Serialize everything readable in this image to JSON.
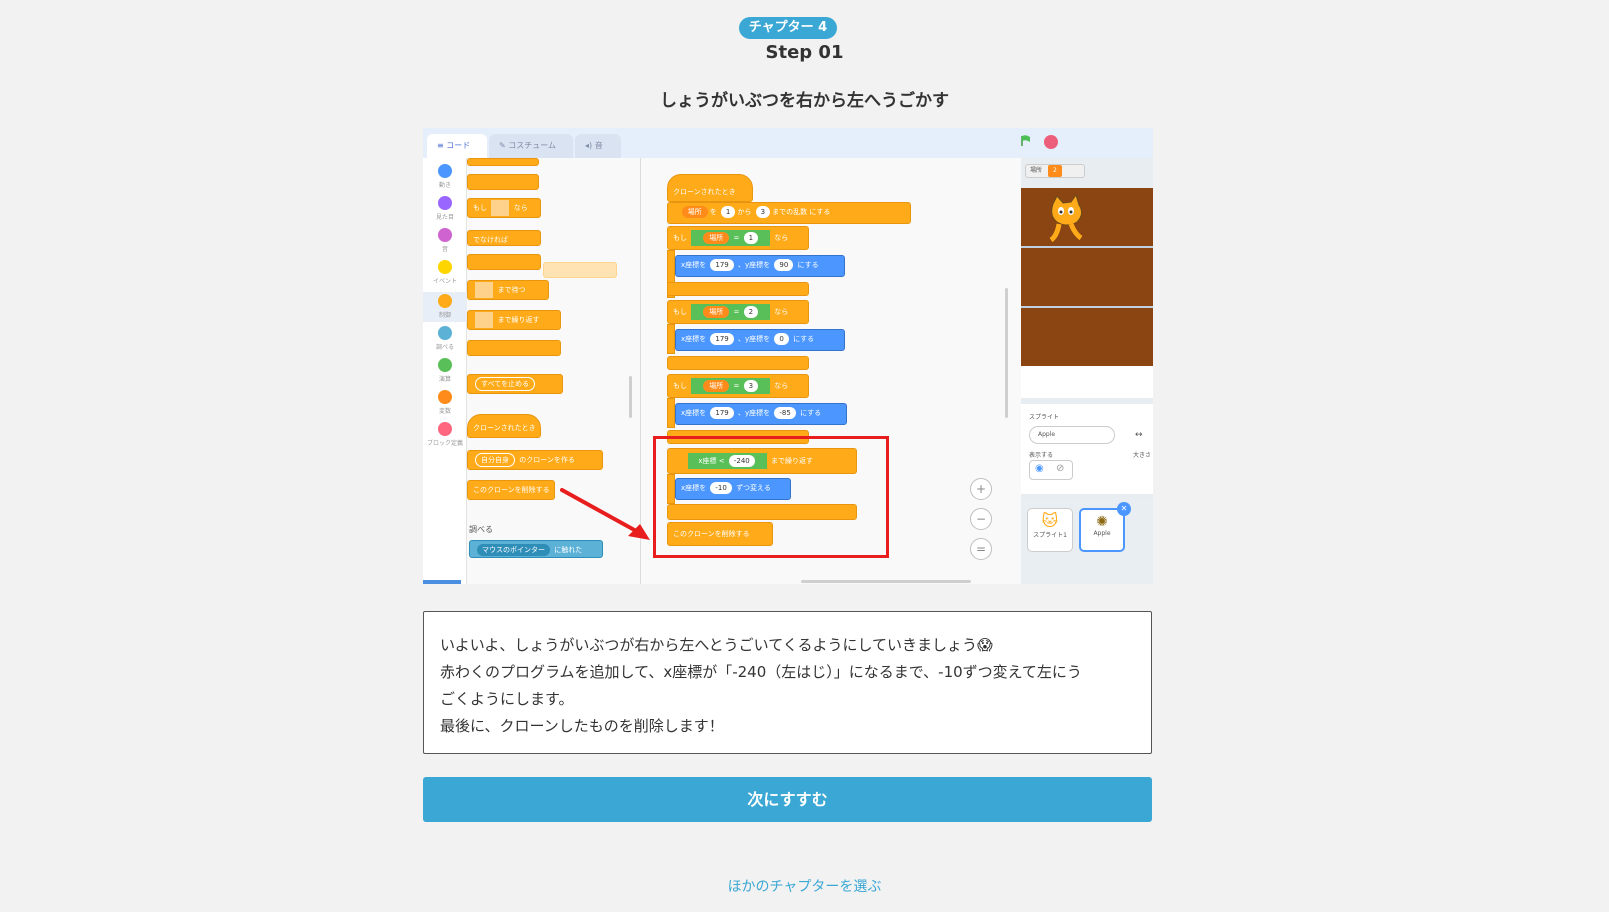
{
  "header": {
    "chapter_badge": "チャプター 4",
    "step": "Step 01",
    "title": "しょうがいぶつを右から左へうごかす"
  },
  "screenshot": {
    "tabs": [
      "コード",
      "コスチューム",
      "音"
    ],
    "categories": [
      "動き",
      "見た目",
      "音",
      "イベント",
      "制御",
      "調べる",
      "演算",
      "変数",
      "ブロック定義"
    ],
    "palette_blocks": [
      "もし",
      "なら",
      "でなければ",
      "まで待つ",
      "まで繰り返す",
      "すべてを止める",
      "クローンされたとき",
      "自分自身",
      "のクローンを作る",
      "このクローンを削除する",
      "調べる",
      "マウスのポインター",
      "に触れた"
    ],
    "script": {
      "hat": "クローンされたとき",
      "set_var": {
        "var": "場所",
        "pre": "を",
        "from": "1",
        "mid": "から",
        "to": "3",
        "post": "までの乱数",
        "end": "にする"
      },
      "if_label": "もし",
      "then_label": "なら",
      "branches": [
        {
          "var": "場所",
          "op": "=",
          "val": "1",
          "x": "179",
          "y": "90"
        },
        {
          "var": "場所",
          "op": "=",
          "val": "2",
          "x": "179",
          "y": "0"
        },
        {
          "var": "場所",
          "op": "=",
          "val": "3",
          "x": "179",
          "y": "-85"
        }
      ],
      "goto_x": "x座標を",
      "goto_y": "y座標を",
      "goto_end": "にする",
      "repeat_until": {
        "left": "x座標",
        "op": "<",
        "right": "-240",
        "label": "まで繰り返す"
      },
      "change_x": {
        "label": "x座標を",
        "val": "-10",
        "post": "ずつ変える"
      },
      "delete_clone": "このクローンを削除する"
    },
    "stage": {
      "var_monitor_label": "場所",
      "var_monitor_value": "2"
    },
    "sprite_panel": {
      "label": "スプライト",
      "name": "Apple",
      "show_label": "表示する",
      "size_label": "大きさ",
      "sprites": [
        "スプライト1",
        "Apple"
      ]
    }
  },
  "description": {
    "lines": [
      "いよいよ、しょうがいぶつが右から左へとうごいてくるようにしていきましょう😱",
      "赤わくのプログラムを追加して、x座標が「-240（左はじ）」になるまで、-10ずつ変えて左にう",
      "ごくようにします。",
      "最後に、クローンしたものを削除します！"
    ]
  },
  "buttons": {
    "next": "次にすすむ",
    "other_chapter": "ほかのチャプターを選ぶ"
  },
  "colors": {
    "accent": "#3aa7d4",
    "control": "#ffab19",
    "motion": "#4c97ff",
    "operator": "#59c059",
    "variable": "#ff8c1a",
    "highlight": "#e81d1d"
  }
}
